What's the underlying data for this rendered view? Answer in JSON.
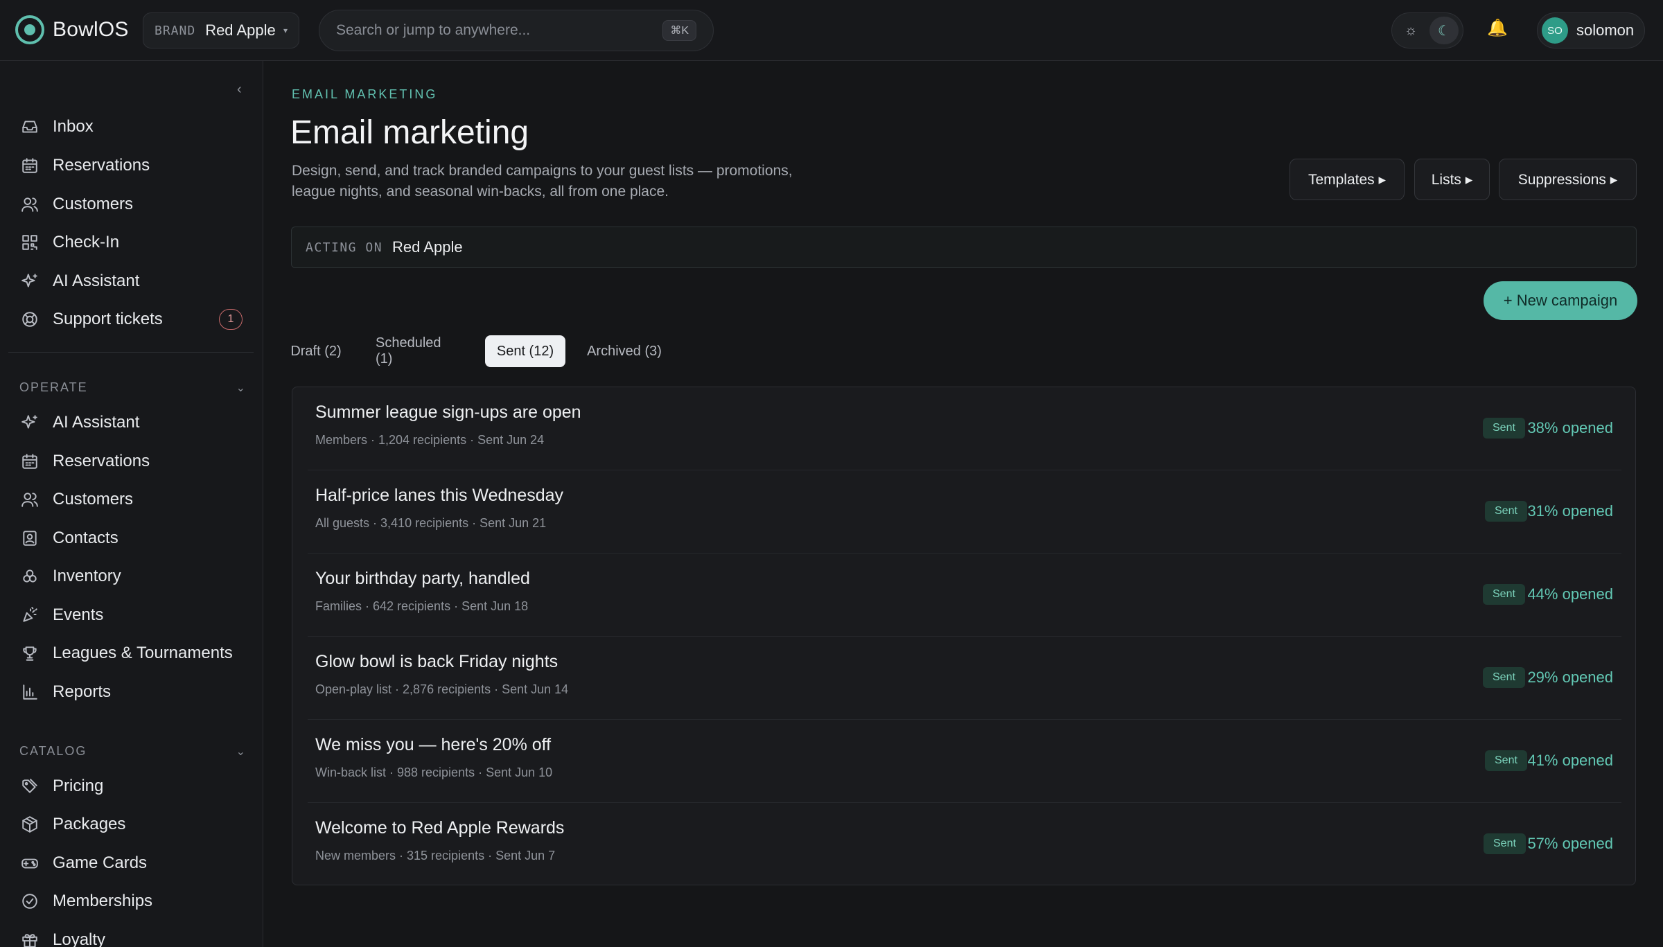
{
  "app": {
    "name": "BowlOS"
  },
  "brand_switcher": {
    "label": "BRAND",
    "value": "Red Apple"
  },
  "search": {
    "placeholder": "Search or jump to anywhere...",
    "shortcut": "⌘K"
  },
  "user": {
    "initials": "SO",
    "name": "solomon"
  },
  "sidebar": {
    "primary": [
      {
        "label": "Inbox",
        "icon": "inbox-icon"
      },
      {
        "label": "Reservations",
        "icon": "calendar-icon"
      },
      {
        "label": "Customers",
        "icon": "users-icon"
      },
      {
        "label": "Check-In",
        "icon": "qr-code-icon"
      },
      {
        "label": "AI Assistant",
        "icon": "sparkles-icon"
      },
      {
        "label": "Support tickets",
        "icon": "lifebuoy-icon",
        "badge": "1"
      }
    ],
    "operate": {
      "title": "OPERATE",
      "items": [
        {
          "label": "AI Assistant",
          "icon": "sparkles-icon"
        },
        {
          "label": "Reservations",
          "icon": "calendar-icon"
        },
        {
          "label": "Customers",
          "icon": "users-icon"
        },
        {
          "label": "Contacts",
          "icon": "contact-card-icon"
        },
        {
          "label": "Inventory",
          "icon": "boxes-icon"
        },
        {
          "label": "Events",
          "icon": "party-popper-icon"
        },
        {
          "label": "Leagues & Tournaments",
          "icon": "trophy-icon"
        },
        {
          "label": "Reports",
          "icon": "bar-chart-icon"
        }
      ]
    },
    "catalog": {
      "title": "CATALOG",
      "items": [
        {
          "label": "Pricing",
          "icon": "tags-icon"
        },
        {
          "label": "Packages",
          "icon": "package-icon"
        },
        {
          "label": "Game Cards",
          "icon": "gamepad-icon"
        },
        {
          "label": "Memberships",
          "icon": "badge-check-icon"
        },
        {
          "label": "Loyalty",
          "icon": "gift-icon"
        }
      ]
    }
  },
  "page": {
    "eyebrow": "EMAIL MARKETING",
    "title": "Email marketing",
    "description": "Design, send, and track branded campaigns to your guest lists — promotions, league nights, and seasonal win-backs, all from one place.",
    "buttons": {
      "templates": "Templates ▸",
      "lists": "Lists ▸",
      "suppressions": "Suppressions ▸"
    },
    "acting_on": {
      "label": "ACTING ON",
      "value": "Red Apple"
    },
    "new_campaign": "+ New campaign",
    "tabs": [
      "Draft (2)",
      "Scheduled (1)",
      "Sent (12)",
      "Archived (3)"
    ],
    "active_tab": "Sent (12)"
  },
  "campaigns": [
    {
      "title": "Summer league sign-ups are open",
      "meta": "Members · 1,204 recipients · Sent Jun 24",
      "status": "Sent",
      "opened": "38% opened"
    },
    {
      "title": "Half-price lanes this Wednesday",
      "meta": "All guests · 3,410 recipients · Sent Jun 21",
      "status": "Sent",
      "opened": "31% opened"
    },
    {
      "title": "Your birthday party, handled",
      "meta": "Families · 642 recipients · Sent Jun 18",
      "status": "Sent",
      "opened": "44% opened"
    },
    {
      "title": "Glow bowl is back Friday nights",
      "meta": "Open-play list · 2,876 recipients · Sent Jun 14",
      "status": "Sent",
      "opened": "29% opened"
    },
    {
      "title": "We miss you — here's 20% off",
      "meta": "Win-back list · 988 recipients · Sent Jun 10",
      "status": "Sent",
      "opened": "41% opened"
    },
    {
      "title": "Welcome to Red Apple Rewards",
      "meta": "New members · 315 recipients · Sent Jun 7",
      "status": "Sent",
      "opened": "57% opened"
    }
  ],
  "colors": {
    "accent": "#55b8a6",
    "background": "#141517",
    "badge_alert": "#c76a6a"
  }
}
